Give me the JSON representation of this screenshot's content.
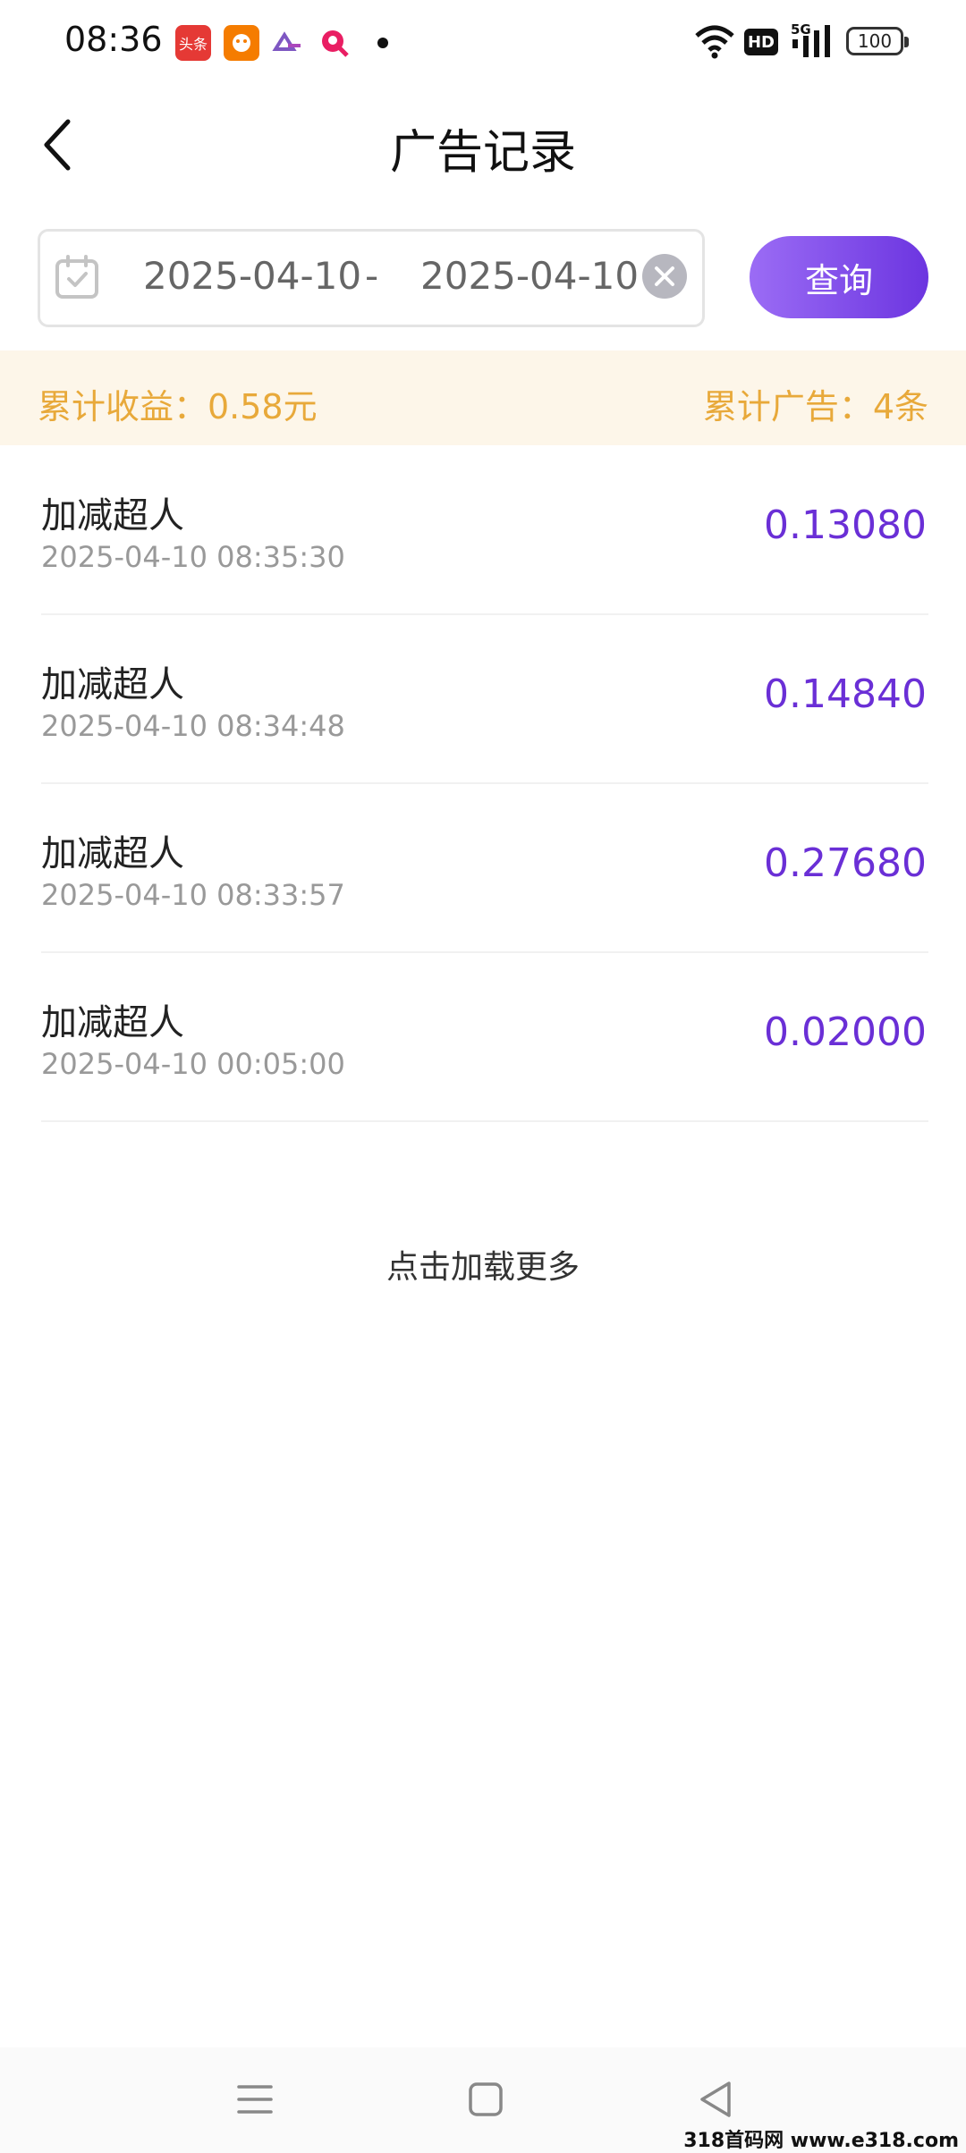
{
  "status_bar": {
    "time": "08:36",
    "notification_icons": [
      {
        "name": "toutiao-app-icon",
        "label": "头条",
        "color": "#e53935"
      },
      {
        "name": "orange-app-icon",
        "label": "",
        "color": "#f57c00"
      },
      {
        "name": "purple-app-icon",
        "label": "",
        "color": "#7e57c2"
      },
      {
        "name": "red-search-app-icon",
        "label": "",
        "color": "#e91e63"
      }
    ],
    "hd_label": "HD",
    "network_label": "5G",
    "battery": "100"
  },
  "header": {
    "title": "广告记录"
  },
  "filter": {
    "start_date": "2025-04-10",
    "separator": "-",
    "end_date": "2025-04-10",
    "query_label": "查询"
  },
  "summary": {
    "earnings": "累计收益：0.58元",
    "ad_count": "累计广告：4条"
  },
  "records": [
    {
      "name": "加减超人",
      "time": "2025-04-10 08:35:30",
      "amount": "0.13080"
    },
    {
      "name": "加减超人",
      "time": "2025-04-10 08:34:48",
      "amount": "0.14840"
    },
    {
      "name": "加减超人",
      "time": "2025-04-10 08:33:57",
      "amount": "0.27680"
    },
    {
      "name": "加减超人",
      "time": "2025-04-10 00:05:00",
      "amount": "0.02000"
    }
  ],
  "load_more": "点击加载更多",
  "watermark": "318首码网 www.e318.com",
  "colors": {
    "accent": "#6a2fd6",
    "summary_text": "#e8a93a",
    "summary_bg": "#fdf6e9"
  }
}
